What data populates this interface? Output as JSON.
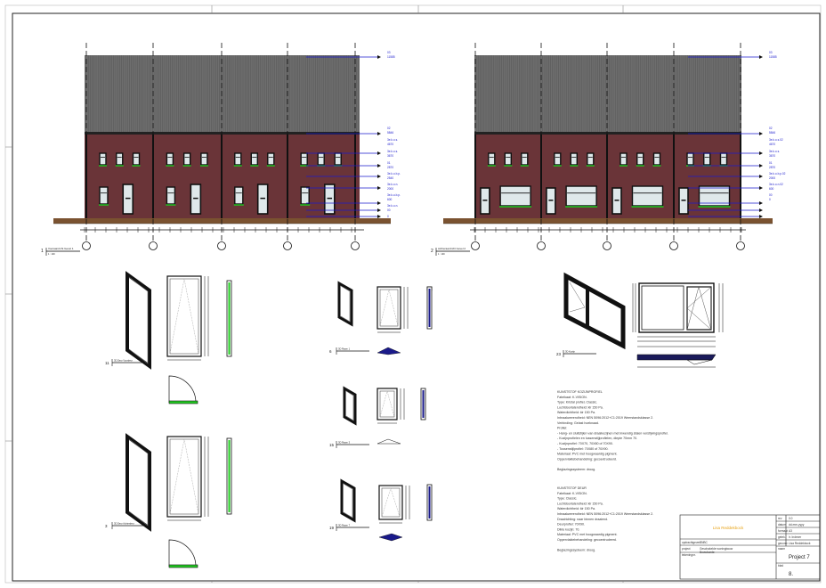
{
  "elevations": [
    {
      "number": "1",
      "title": "Vooraanzicht Gevel 1",
      "scale": "1 : 100",
      "levels": [
        "03",
        "11585",
        "02",
        "5846",
        "3e.k.o.s.",
        "4670",
        "3e.k.o.s.",
        "3670",
        "01",
        "2870",
        "3e.k.o.b.p.",
        "2540",
        "3e.k.o.n.",
        "2000",
        "3e.k.o.b.p.",
        "600",
        "3e.k.o.n.",
        "00",
        "0"
      ]
    },
    {
      "number": "2",
      "title": "Achteraanzicht Gevel 2",
      "scale": "1 : 100",
      "levels": [
        "03",
        "11585",
        "02",
        "5846",
        "3e.k.o.s.02",
        "4670",
        "3e.k.o.s.",
        "3670",
        "01",
        "2870",
        "3e.k.o.b.p.02",
        "2000",
        "3e.k.o.n.02",
        "600",
        "00",
        "0"
      ]
    }
  ],
  "details": [
    {
      "number": "11",
      "title": "3D Deur Voordeur"
    },
    {
      "number": "3",
      "title": "3D Deur Achterdeur"
    },
    {
      "number": "6",
      "title": "3D Raam 1"
    },
    {
      "number": "15",
      "title": "3D Raam 3"
    },
    {
      "number": "19",
      "title": "3D Raam 7"
    },
    {
      "number": "23",
      "title": "3D Kozijn"
    }
  ],
  "spec1": [
    "KUNSTSTOF KOZIJNPROFIEL",
    "Fabrikaat: K-VISION.",
    "Type: Kristal profiel, Classic.",
    "Luchtdoorlatendheid: klr 150 Pa.",
    "Waterdichtheid: klr 150 Pa.",
    "Inbraakwerendheid: NEN 5096:2012+C1:2019 Weerstandsklasse 2.",
    "Verbinding: Gelast hoeknaad.",
    "Profiel:",
    "- Hang- en sluitstijlen van draaikozijnen met inwendig stalen verstijvingsprofiel.",
    "- Kozijnprofielen en tussenstijlprofielen, diepte 70mm 70.",
    "- Kozijnprofiel: 70X70, 70X80 of 70X90.",
    "- Tussenstijlprofiel: 70X80 of 70X90.",
    "Materiaal: PVC met hoogwaardig pigment.",
    "Oppervlaktebehandeling: gecoextrudeerd.",
    "",
    "Beglazingssysteem: droog."
  ],
  "spec2": [
    "KUNSTSTOF DEUR",
    "Fabrikaat: K-VISION.",
    "Type: Classic.",
    "Luchtdoorlatendheid: klr 150 Pa.",
    "Waterdichtheid: klr 150 Pa.",
    "Inbraakwerendheid: NEN 5096:2012+C1:2019 Weerstandsklasse 2.",
    "Draairichting: naar binnen draaiend.",
    "Deurprofiel: 70X90.",
    "Dikte kozijn: 70.",
    "Materiaal: PVC met hoogwaardig pigment.",
    "Oppervlaktebehandeling: gecoextrudeerd.",
    "",
    "Beglazingssysteem: droog."
  ],
  "title_block": {
    "author": "Lisa Reddekbock",
    "client_label": "opdrachtgever",
    "client": "BNBC",
    "project_label": "project",
    "project_desc": "Geschakelde woningbouw",
    "project_desc2": "Bouwkunde",
    "phase_label": "tekeningnr.",
    "fields": [
      {
        "label": "rev",
        "value": "0.0"
      },
      {
        "label": "datum",
        "value": "dd-mm-yyyy"
      },
      {
        "label": "formaat",
        "value": "A3"
      },
      {
        "label": "getek.",
        "value": "Ir. Indexer"
      },
      {
        "label": "gecontr.",
        "value": "Lisa Reddekbock"
      }
    ],
    "project_name_label": "naam",
    "project_name": "Project 7",
    "sheet_label": "blad",
    "sheet": "8."
  },
  "colors": {
    "brick": "#6a3438",
    "roof": "#6e6e6e",
    "ground": "#7a5230",
    "level": "#1a1acc",
    "sill": "#22cc22",
    "author": "#e8a317"
  }
}
